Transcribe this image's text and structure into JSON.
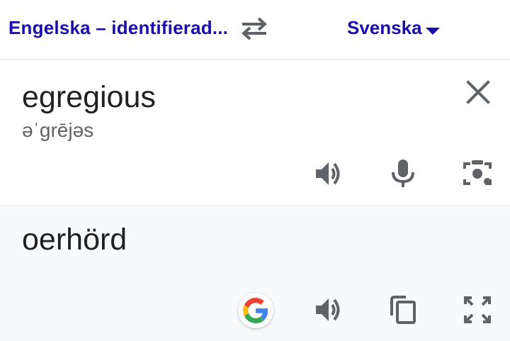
{
  "header": {
    "source_language": "Engelska – identifierad...",
    "target_language": "Svenska",
    "swap_icon": "swap-horizontal-icon",
    "target_caret_icon": "caret-down-icon"
  },
  "input": {
    "text": "egregious",
    "phonetic": "əˈgrējəs",
    "icons": [
      "close-icon",
      "speaker-icon",
      "microphone-icon",
      "camera-icon"
    ]
  },
  "output": {
    "text": "oerhörd",
    "icons": [
      "google-icon",
      "speaker-icon",
      "copy-icon",
      "fullscreen-icon"
    ]
  },
  "colors": {
    "language_link": "#1a0dab",
    "icon_gray": "#5f6368",
    "text": "#202124",
    "output_background": "#f8f9fa",
    "divider": "#dadce0",
    "google_blue": "#4285F4",
    "google_red": "#EA4335",
    "google_yellow": "#FBBC05",
    "google_green": "#34A853"
  }
}
